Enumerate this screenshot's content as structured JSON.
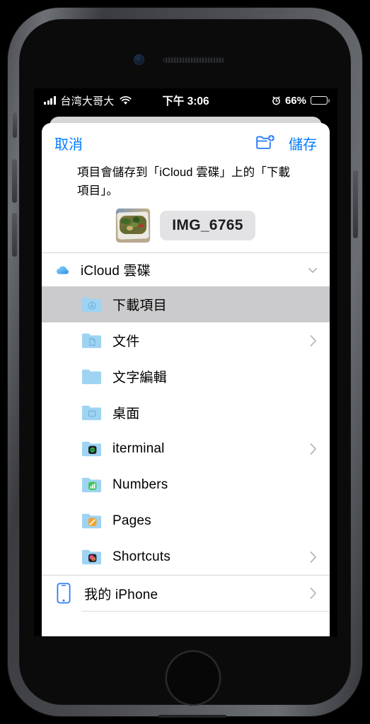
{
  "status_bar": {
    "carrier": "台湾大哥大",
    "wifi_icon": "wifi-icon",
    "time": "下午 3:06",
    "alarm_icon": "alarm-clock-icon",
    "battery_percent": "66%",
    "battery_level": 66
  },
  "sheet": {
    "cancel_label": "取消",
    "new_folder_icon": "new-folder-icon",
    "save_label": "儲存",
    "description": "項目會儲存到「iCloud 雲碟」上的「下載項目」。",
    "file": {
      "name": "IMG_6765",
      "thumbnail_icon": "photo-thumbnail"
    }
  },
  "browser": {
    "sources": [
      {
        "id": "icloud-drive",
        "label": "iCloud 雲碟",
        "icon": "icloud-icon",
        "expanded": true,
        "disclosure_icon": "chevron-down-icon",
        "folders": [
          {
            "label": "下載項目",
            "icon": "folder-downloads-icon",
            "selected": true,
            "has_chevron": false
          },
          {
            "label": "文件",
            "icon": "folder-documents-icon",
            "selected": false,
            "has_chevron": true
          },
          {
            "label": "文字編輯",
            "icon": "folder-plain-icon",
            "selected": false,
            "has_chevron": false
          },
          {
            "label": "桌面",
            "icon": "folder-desktop-icon",
            "selected": false,
            "has_chevron": false
          },
          {
            "label": "iterminal",
            "icon": "folder-app-iterminal",
            "selected": false,
            "has_chevron": true
          },
          {
            "label": "Numbers",
            "icon": "folder-app-numbers",
            "selected": false,
            "has_chevron": false
          },
          {
            "label": "Pages",
            "icon": "folder-app-pages",
            "selected": false,
            "has_chevron": false
          },
          {
            "label": "Shortcuts",
            "icon": "folder-app-shortcuts",
            "selected": false,
            "has_chevron": true
          }
        ]
      }
    ],
    "device": {
      "label": "我的 iPhone",
      "icon": "iphone-icon",
      "has_chevron": true
    }
  },
  "colors": {
    "accent_blue": "#007aff",
    "folder_blue": "#7ec8f0",
    "selected_row": "#cbcbcd",
    "chip_gray": "#e3e3e5",
    "separator": "#dcdcde"
  }
}
